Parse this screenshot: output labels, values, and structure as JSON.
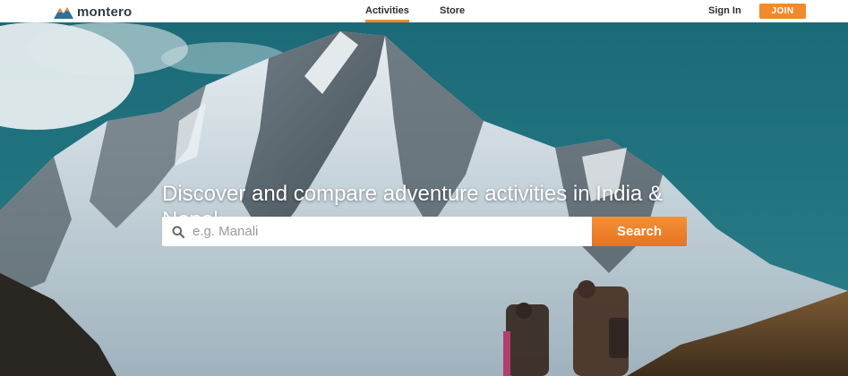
{
  "brand": {
    "name": "montero",
    "colors": {
      "accent": "#f08a2c",
      "sky": "#1f6d7a"
    }
  },
  "nav": {
    "links": [
      {
        "label": "Activities",
        "active": true
      },
      {
        "label": "Store",
        "active": false
      }
    ],
    "signin_label": "Sign In",
    "join_label": "JOIN"
  },
  "hero": {
    "headline": "Discover and compare adventure activities in India & Nepal",
    "search": {
      "placeholder": "e.g. Manali",
      "value": "",
      "button_label": "Search",
      "icon": "search-icon"
    }
  }
}
